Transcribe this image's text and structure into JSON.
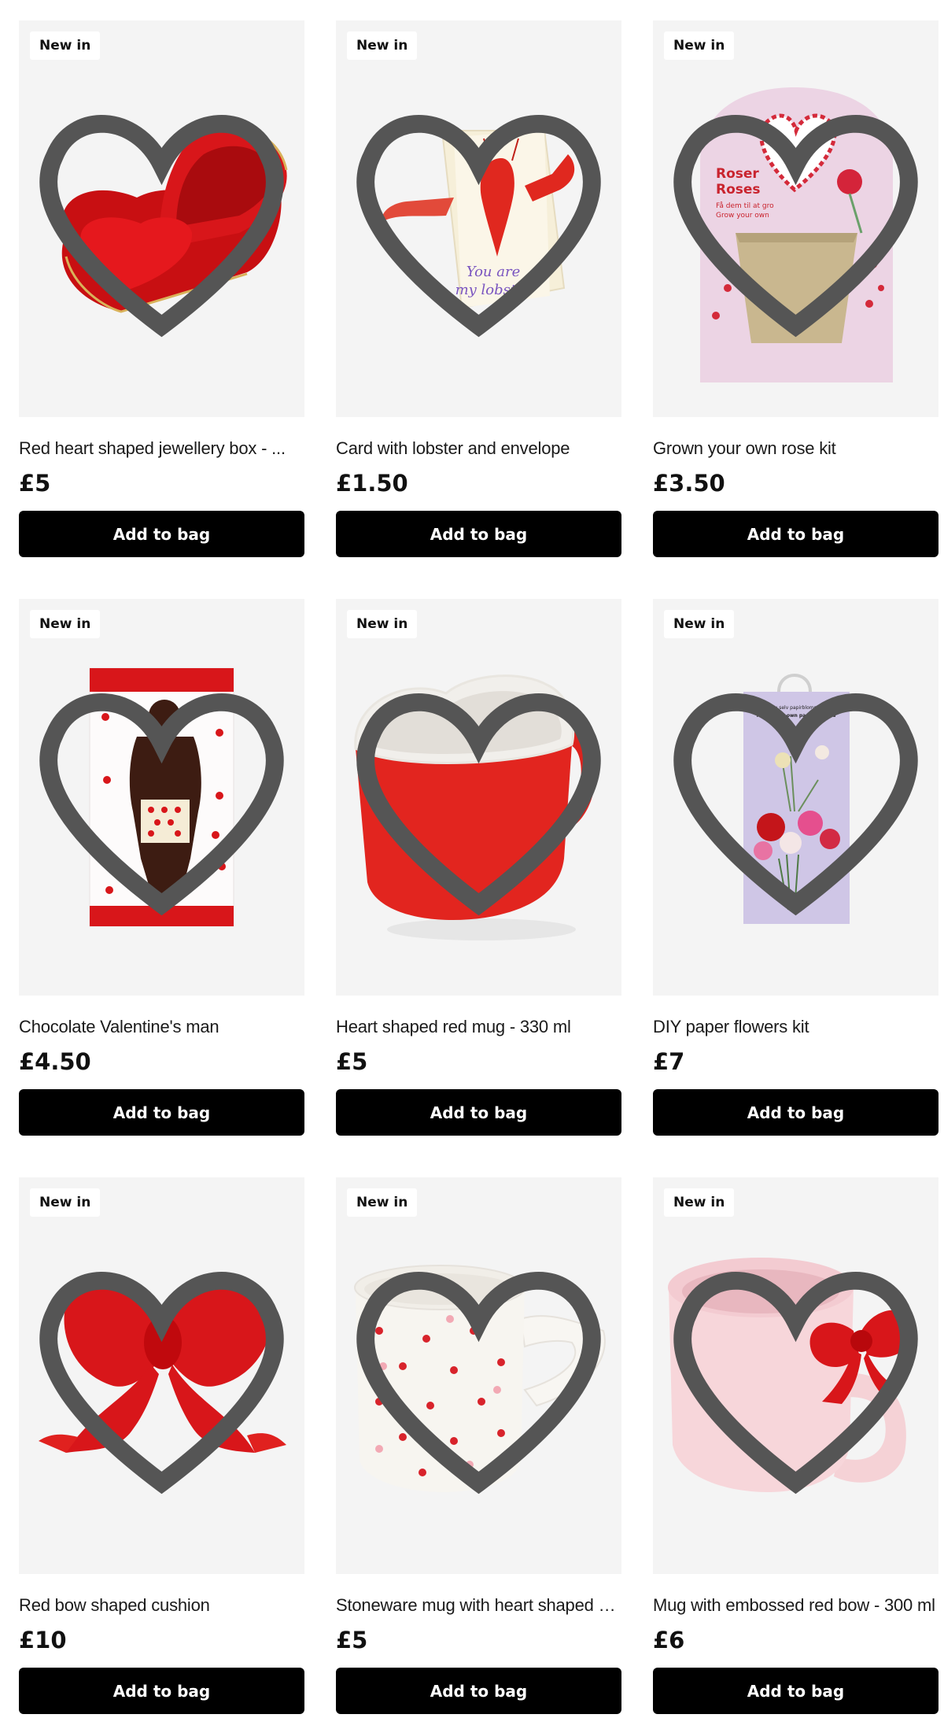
{
  "theme": {
    "button_bg": "#000000",
    "button_fg": "#ffffff",
    "card_bg": "#f4f4f4",
    "accent_red": "#e01818"
  },
  "products": [
    {
      "badge": "New in",
      "name": "Red heart shaped jewellery box - ...",
      "price": "£5",
      "button": "Add to bag",
      "image_icon": "heart-jewellery-box-image"
    },
    {
      "badge": "New in",
      "name": "Card with lobster and envelope",
      "price": "£1.50",
      "button": "Add to bag",
      "image_icon": "lobster-card-image",
      "image_text": [
        "You are",
        "my lobster"
      ]
    },
    {
      "badge": "New in",
      "name": "Grown your own rose kit",
      "price": "£3.50",
      "button": "Add to bag",
      "image_icon": "rose-kit-image",
      "image_text": [
        "Roser",
        "Roses",
        "Få dem til at gro",
        "Grow your own"
      ]
    },
    {
      "badge": "New in",
      "name": "Chocolate Valentine's man",
      "price": "£4.50",
      "button": "Add to bag",
      "image_icon": "chocolate-man-image"
    },
    {
      "badge": "New in",
      "name": "Heart shaped red mug - 330 ml",
      "price": "£5",
      "button": "Add to bag",
      "image_icon": "heart-mug-image"
    },
    {
      "badge": "New in",
      "name": "DIY paper flowers kit",
      "price": "£7",
      "button": "Add to bag",
      "image_icon": "paper-flowers-kit-image",
      "image_text": [
        "Lav selv papirblomster",
        "Make-your-own paper flowers"
      ]
    },
    {
      "badge": "New in",
      "name": "Red bow shaped cushion",
      "price": "£10",
      "button": "Add to bag",
      "image_icon": "bow-cushion-image"
    },
    {
      "badge": "New in",
      "name": "Stoneware mug with heart shaped h...",
      "price": "£5",
      "button": "Add to bag",
      "image_icon": "heart-pattern-mug-image"
    },
    {
      "badge": "New in",
      "name": "Mug with embossed red bow - 300 ml",
      "price": "£6",
      "button": "Add to bag",
      "image_icon": "bow-mug-image"
    }
  ]
}
